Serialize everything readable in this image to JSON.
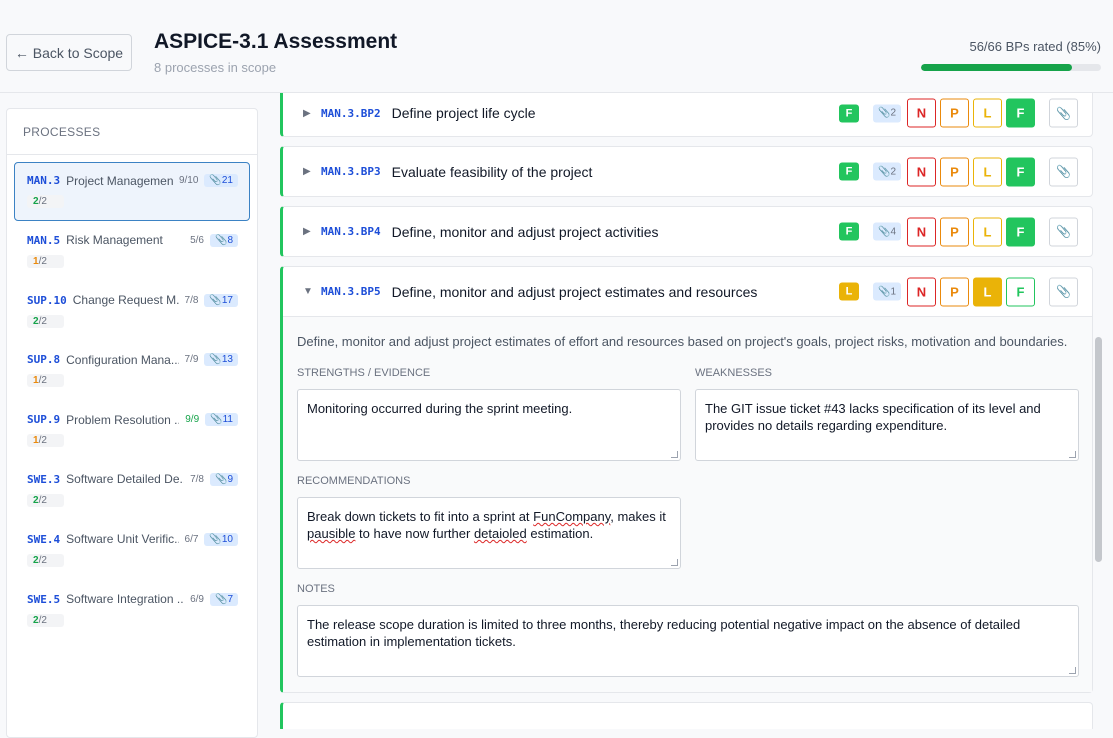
{
  "header": {
    "back_label": "← Back to Scope",
    "title": "ASPICE-3.1 Assessment",
    "subtitle": "8 processes in scope",
    "progress_text": "56/66 BPs rated (85%)",
    "progress_fraction": 0.85
  },
  "sidebar": {
    "title": "PROCESSES",
    "processes": [
      {
        "code": "MAN.3",
        "name": "Project Management",
        "count": "9/10",
        "evidence": "21",
        "cl_done": "2",
        "cl_total": "/2",
        "active": true
      },
      {
        "code": "MAN.5",
        "name": "Risk Management",
        "count": "5/6",
        "evidence": "8",
        "cl_done": "1",
        "cl_total": "/2",
        "active": false
      },
      {
        "code": "SUP.10",
        "name": "Change Request M...",
        "count": "7/8",
        "evidence": "17",
        "cl_done": "2",
        "cl_total": "/2",
        "active": false
      },
      {
        "code": "SUP.8",
        "name": "Configuration Mana...",
        "count": "7/9",
        "evidence": "13",
        "cl_done": "1",
        "cl_total": "/2",
        "active": false
      },
      {
        "code": "SUP.9",
        "name": "Problem Resolution ...",
        "count": "9/9",
        "evidence": "11",
        "cl_done": "1",
        "cl_total": "/2",
        "active": false
      },
      {
        "code": "SWE.3",
        "name": "Software Detailed De...",
        "count": "7/8",
        "evidence": "9",
        "cl_done": "2",
        "cl_total": "/2",
        "active": false
      },
      {
        "code": "SWE.4",
        "name": "Software Unit Verific...",
        "count": "6/7",
        "evidence": "10",
        "cl_done": "2",
        "cl_total": "/2",
        "active": false
      },
      {
        "code": "SWE.5",
        "name": "Software Integration ...",
        "count": "6/9",
        "evidence": "7",
        "cl_done": "2",
        "cl_total": "/2",
        "active": false
      }
    ]
  },
  "rating_labels": [
    "N",
    "P",
    "L",
    "F"
  ],
  "base_practices": [
    {
      "code": "MAN.3.BP2",
      "title": "Define project life cycle",
      "rating": "F",
      "evidence": "2",
      "expanded": false
    },
    {
      "code": "MAN.3.BP3",
      "title": "Evaluate feasibility of the project",
      "rating": "F",
      "evidence": "2",
      "expanded": false
    },
    {
      "code": "MAN.3.BP4",
      "title": "Define, monitor and adjust project activities",
      "rating": "F",
      "evidence": "4",
      "expanded": false
    },
    {
      "code": "MAN.3.BP5",
      "title": "Define, monitor and adjust project estimates and resources",
      "rating": "L",
      "evidence": "1",
      "expanded": true
    }
  ],
  "expanded": {
    "description": "Define, monitor and adjust project estimates of effort and resources based on project's goals, project risks, motivation and boundaries.",
    "strengths_label": "STRENGTHS / EVIDENCE",
    "strengths_value": "Monitoring occurred during the sprint meeting.",
    "weaknesses_label": "WEAKNESSES",
    "weaknesses_value": "The GIT issue ticket #43 lacks specification of its level and provides no details regarding expenditure.",
    "recommendations_label": "RECOMMENDATIONS",
    "recommendations_pre": "Break down tickets to fit into a sprint at ",
    "recommendations_word1": "FunCompany",
    "recommendations_mid": ", makes it ",
    "recommendations_word2": "pausible",
    "recommendations_mid2": " to have now further ",
    "recommendations_word3": "detaioled",
    "recommendations_post": " estimation.",
    "notes_label": "NOTES",
    "notes_value": "The release scope duration is limited to three months, thereby reducing potential negative impact on the absence of detailed estimation in implementation tickets."
  },
  "colors": {
    "accent": "#1d4ed8",
    "fully": "#22c55e",
    "largely": "#eab308",
    "partially": "#ea8a0c",
    "not": "#dc2626",
    "progress": "#16a34a"
  },
  "icons": {
    "caret_collapsed": "▶",
    "caret_expanded": "▼",
    "evidence": "paperclip-icon",
    "attach": "paperclip-icon"
  }
}
